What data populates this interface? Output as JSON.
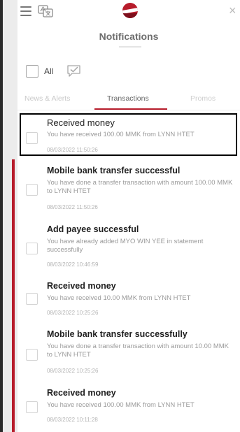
{
  "header": {
    "title": "Notifications",
    "menu_icon": "hamburger-menu-icon",
    "language_icon": "language-translate-icon",
    "logo": "bank-logo",
    "close_icon": "close-icon",
    "accent_color": "#b71c2b"
  },
  "select_all": {
    "label": "All",
    "action_icon": "mark-read-icon"
  },
  "tabs": [
    {
      "label": "News & Alerts",
      "active": false
    },
    {
      "label": "Transactions",
      "active": true
    },
    {
      "label": "Promos",
      "active": false
    }
  ],
  "notifications": [
    {
      "title": "Received money",
      "body": "You have received 100.00 MMK from LYNN HTET",
      "date": "08/03/2022 11:50:26"
    },
    {
      "title": "Mobile bank transfer successful",
      "body": "You have done a transfer transaction with amount 100.00 MMK to LYNN HTET",
      "date": "08/03/2022 11:50:26"
    },
    {
      "title": "Add payee successful",
      "body": "You have already added MYO WIN YEE in statement successfully",
      "date": "08/03/2022 10:46:59"
    },
    {
      "title": "Received money",
      "body": "You have received 10.00 MMK from LYNN HTET",
      "date": "08/03/2022 10:25:26"
    },
    {
      "title": "Mobile bank transfer successfully",
      "body": "You have done a transfer transaction with amount 10.00 MMK to LYNN HTET",
      "date": "08/03/2022 10:25:26"
    },
    {
      "title": "Received money",
      "body": "You have received 100.00 MMK from LYNN HTET",
      "date": "08/03/2022 10:11:28"
    }
  ]
}
